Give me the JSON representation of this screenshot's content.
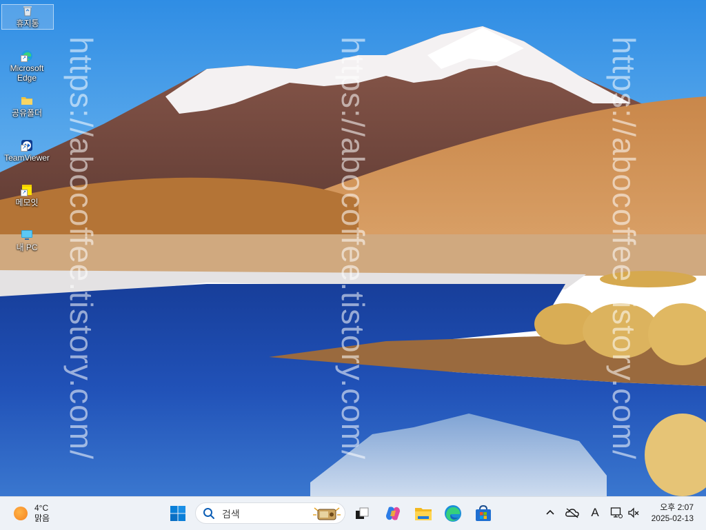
{
  "desktop": {
    "icons": [
      {
        "label": "휴지통",
        "icon": "recycle-bin-icon"
      },
      {
        "label": "Microsoft Edge",
        "icon": "edge-icon"
      },
      {
        "label": "공유폴더",
        "icon": "folder-icon"
      },
      {
        "label": "TeamViewer",
        "icon": "teamviewer-icon"
      },
      {
        "label": "메모잇",
        "icon": "memo-icon"
      },
      {
        "label": "내 PC",
        "icon": "this-pc-icon"
      }
    ],
    "watermark": "https://abocoffee.tistory.com/"
  },
  "taskbar": {
    "weather": {
      "temp": "4°C",
      "condition": "맑음",
      "icon": "sun-icon"
    },
    "search": {
      "placeholder": "검색"
    },
    "apps": [
      {
        "name": "start",
        "icon": "windows-start-icon"
      },
      {
        "name": "task-view",
        "icon": "task-view-icon"
      },
      {
        "name": "copilot",
        "icon": "copilot-icon"
      },
      {
        "name": "file-explorer",
        "icon": "file-explorer-icon"
      },
      {
        "name": "edge",
        "icon": "edge-icon"
      },
      {
        "name": "store",
        "icon": "microsoft-store-icon"
      }
    ],
    "tray": {
      "icons": [
        "chevron-up-icon",
        "onedrive-icon",
        "ime-icon",
        "network-icon",
        "volume-mute-icon"
      ],
      "ime_label": "A"
    },
    "clock": {
      "time": "오후 2:07",
      "date": "2025-02-13"
    }
  },
  "colors": {
    "taskbar_bg": "#eef2f7",
    "accent": "#0078d4"
  }
}
